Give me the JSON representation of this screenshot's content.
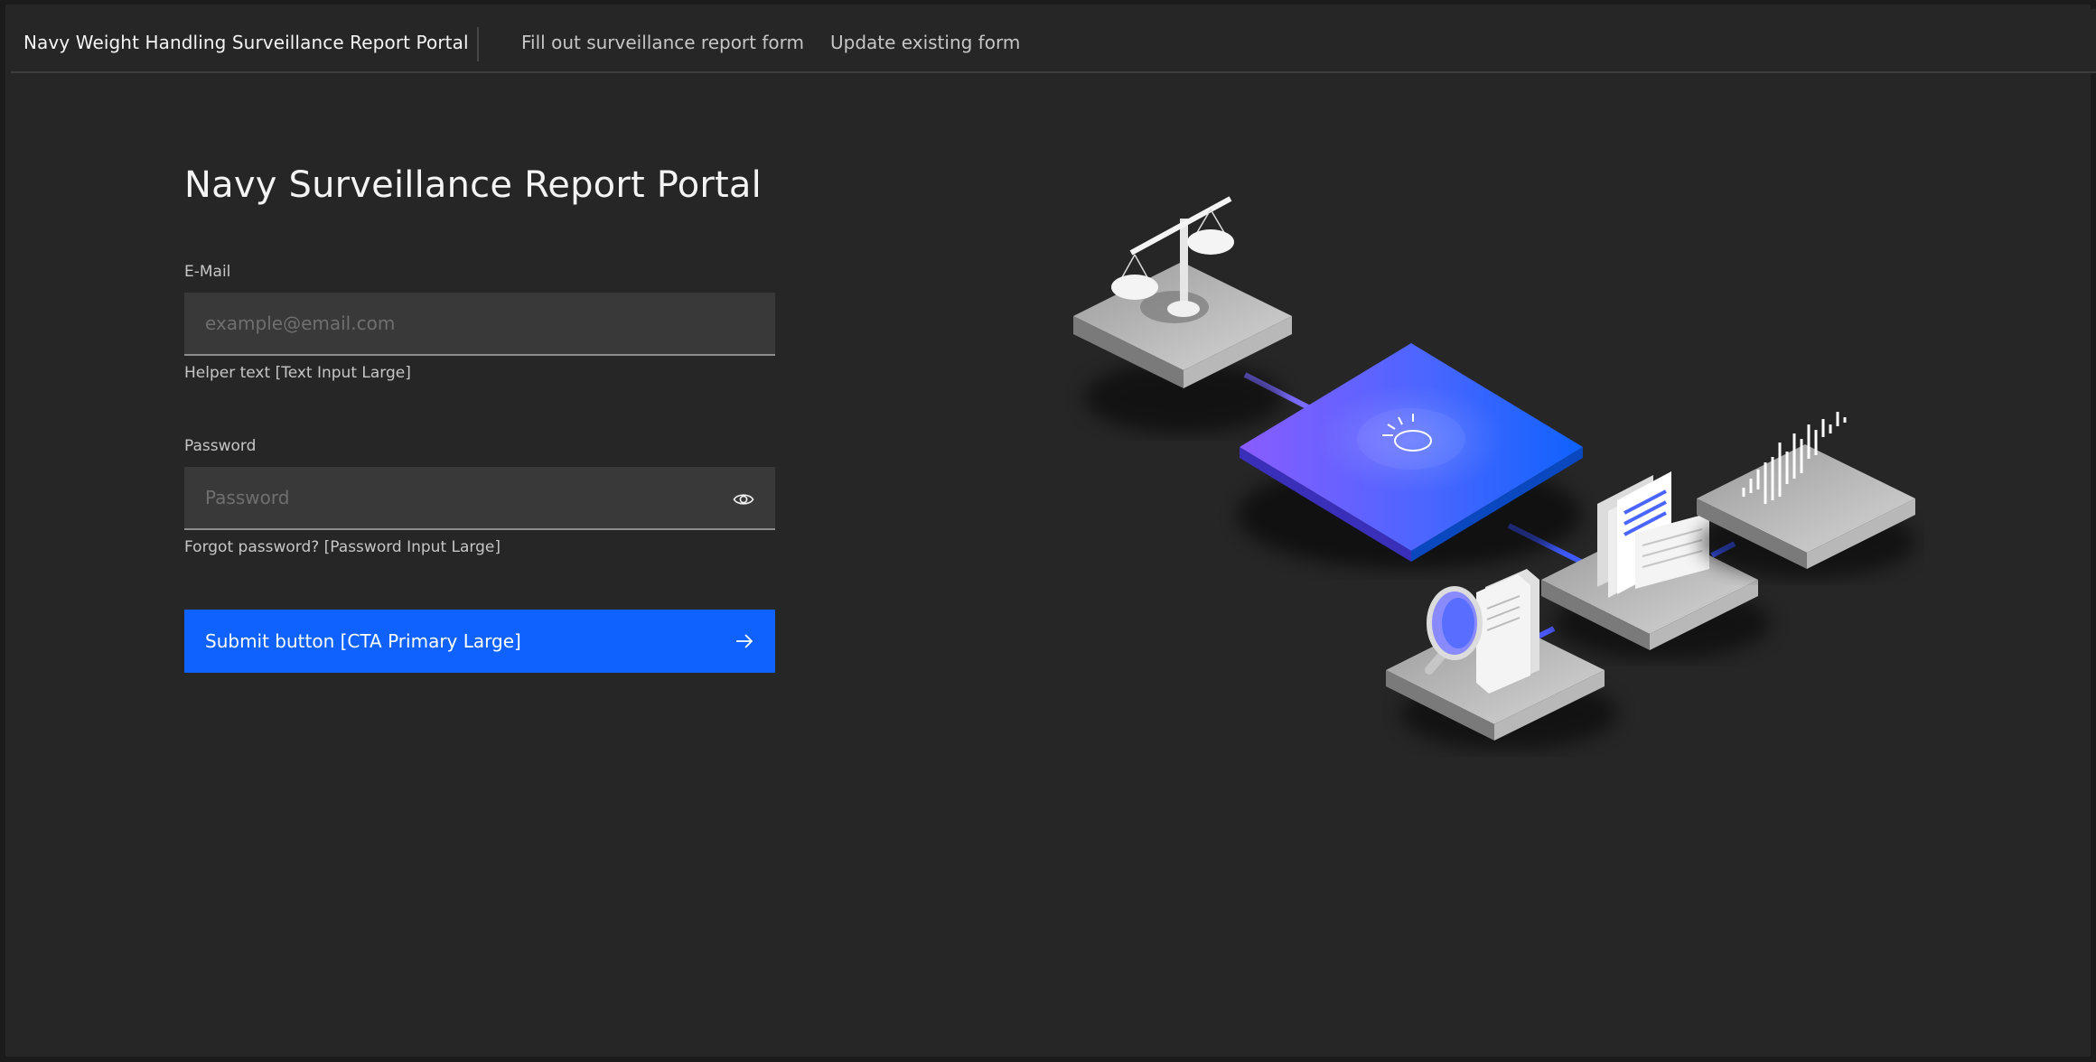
{
  "header": {
    "app_title": "Navy Weight Handling Surveillance Report Portal",
    "nav": [
      {
        "label": "Fill out surveillance report form"
      },
      {
        "label": "Update existing form"
      }
    ]
  },
  "form": {
    "title": "Navy Surveillance Report Portal",
    "email": {
      "label": "E-Mail",
      "placeholder": "example@email.com",
      "value": "",
      "helper": "Helper text [Text Input Large]"
    },
    "password": {
      "label": "Password",
      "placeholder": "Password",
      "value": "",
      "helper": "Forgot password?  [Password Input Large]",
      "reveal_icon": "eye-icon"
    },
    "submit": {
      "label": "Submit button [CTA Primary Large]",
      "icon": "arrow-right-icon"
    }
  },
  "illustration": {
    "icons": [
      "scales-of-justice-icon",
      "ibm-logo-icon",
      "documents-icon",
      "magnifier-icon",
      "signal-bars-icon"
    ]
  },
  "colors": {
    "background": "#262626",
    "input": "#393939",
    "primary": "#0f62fe",
    "text": "#f4f4f4",
    "muted": "#c6c6c6"
  }
}
